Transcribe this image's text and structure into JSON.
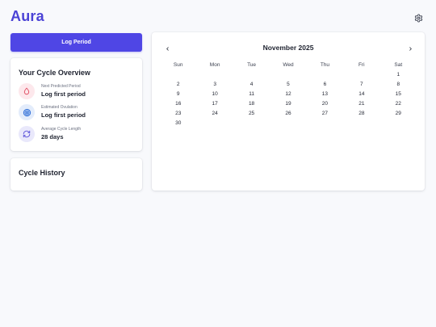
{
  "app": {
    "title": "Aura"
  },
  "header": {
    "settings_icon": "gear-icon"
  },
  "actions": {
    "log_period_label": "Log Period"
  },
  "overview": {
    "title": "Your Cycle Overview",
    "stats": [
      {
        "label": "Next Predicted Period",
        "value": "Log first period",
        "icon": "droplet-icon",
        "bg": "#fde8ec",
        "color": "#e04a5f"
      },
      {
        "label": "Estimated Ovulation",
        "value": "Log first period",
        "icon": "target-icon",
        "bg": "#e3ecfb",
        "color": "#2f6fd8"
      },
      {
        "label": "Average Cycle Length",
        "value": "28 days",
        "icon": "refresh-icon",
        "bg": "#e9e8fb",
        "color": "#5a51d9"
      }
    ]
  },
  "history": {
    "title": "Cycle History"
  },
  "calendar": {
    "month_label": "November 2025",
    "weekdays": [
      "Sun",
      "Mon",
      "Tue",
      "Wed",
      "Thu",
      "Fri",
      "Sat"
    ],
    "days": [
      "",
      "",
      "",
      "",
      "",
      "",
      "1",
      "2",
      "3",
      "4",
      "5",
      "6",
      "7",
      "8",
      "9",
      "10",
      "11",
      "12",
      "13",
      "14",
      "15",
      "16",
      "17",
      "18",
      "19",
      "20",
      "21",
      "22",
      "23",
      "24",
      "25",
      "26",
      "27",
      "28",
      "29",
      "30",
      "",
      "",
      "",
      "",
      "",
      ""
    ]
  },
  "colors": {
    "accent": "#4f46e5",
    "brand": "#4b43d6",
    "background": "#f8f9fc"
  }
}
